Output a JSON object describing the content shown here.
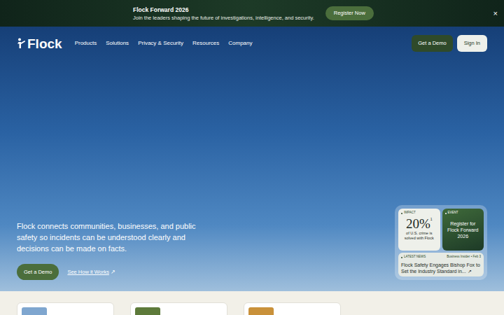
{
  "banner": {
    "title": "Flock Forward 2026",
    "subtitle": "Join the leaders shaping the future of investigations, intelligence, and security.",
    "button": "Register Now",
    "close": "×"
  },
  "logo": "Flock",
  "nav": [
    "Products",
    "Solutions",
    "Privacy & Security",
    "Resources",
    "Company"
  ],
  "actions": [
    {
      "label": "Get a Demo",
      "kind": "primary"
    },
    {
      "label": "Sign In",
      "kind": "secondary"
    }
  ],
  "hero": {
    "text": "Flock connects communities, businesses, and public safety so incidents can be understood clearly and decisions can be made on facts.",
    "primary_button": "Get a Demo",
    "link": "See How it Works",
    "link_icon": "↗"
  },
  "highlights": {
    "impact": {
      "label": "IMPACT",
      "value": "20%",
      "footnote": "1",
      "caption": "of U.S. crime is solved with Flock"
    },
    "event": {
      "label": "EVENT",
      "title": "Register for Flock Forward 2026"
    },
    "news": {
      "label": "LATEST NEWS",
      "source": "Business Insider",
      "separator": "•",
      "date": "Feb 3",
      "title": "Flock Safety Engages Bishop Fox to Set the Industry Standard in...",
      "icon": "↗"
    }
  },
  "cards": [
    {
      "color": "#7fa6cf"
    },
    {
      "color": "#5d7a3a"
    },
    {
      "color": "#c9913a"
    }
  ]
}
